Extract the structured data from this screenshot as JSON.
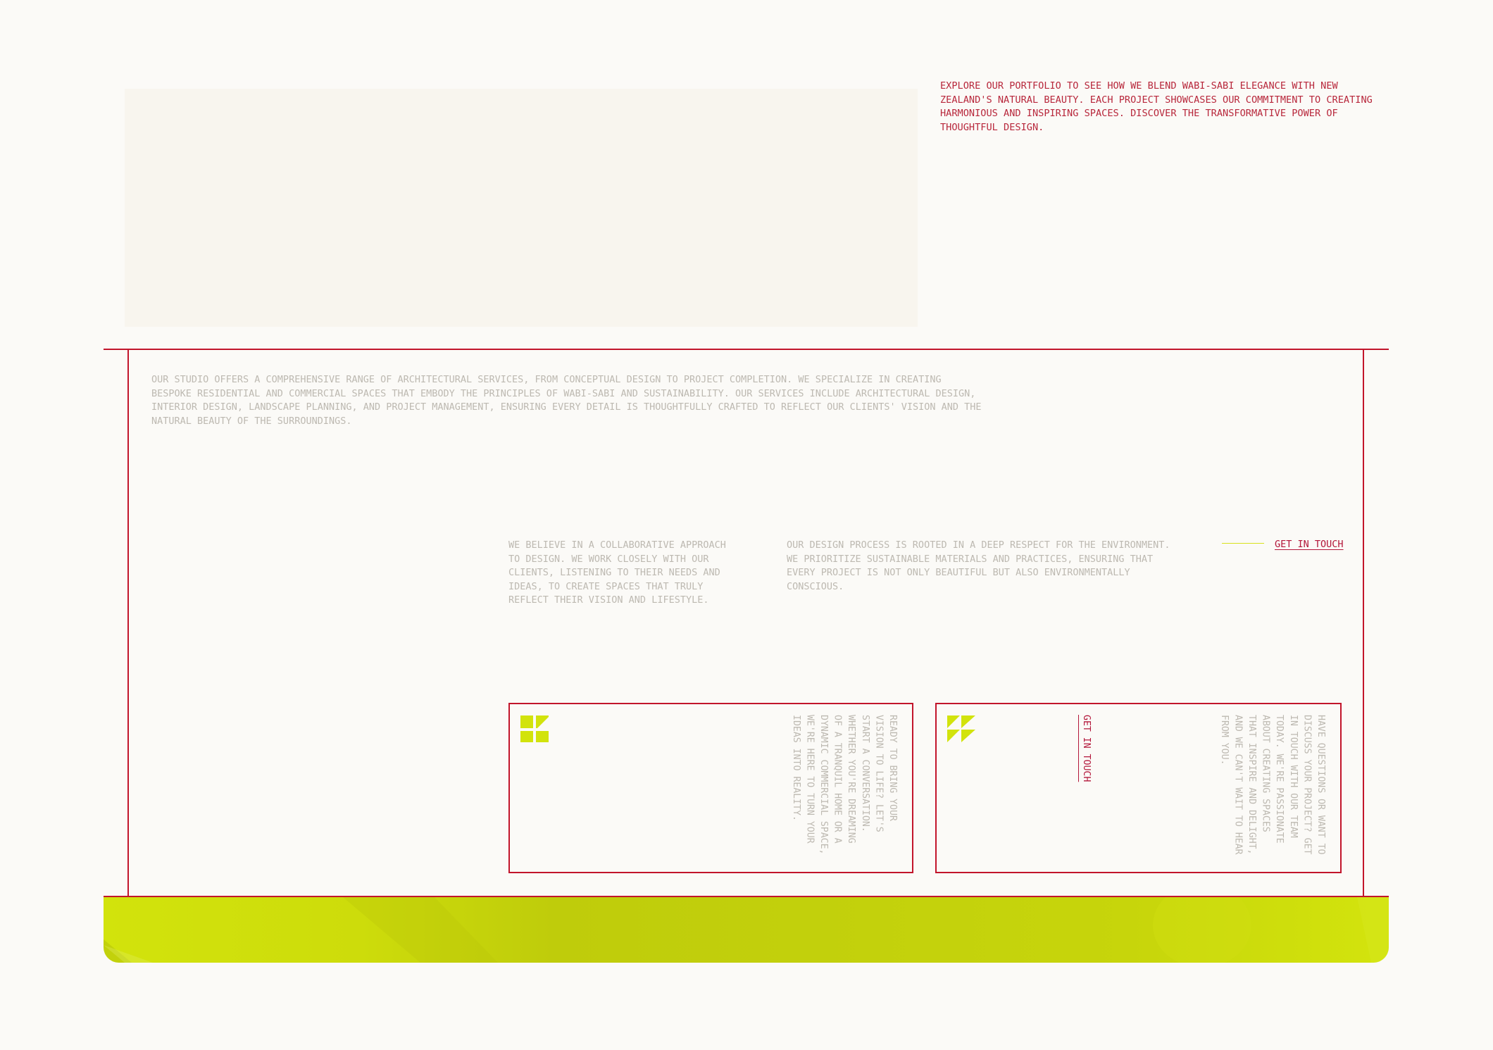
{
  "portfolio": {
    "text": "EXPLORE OUR PORTFOLIO TO SEE HOW WE BLEND WABI-SABI ELEGANCE WITH NEW ZEALAND'S NATURAL BEAUTY. EACH PROJECT SHOWCASES OUR COMMITMENT TO CREATING HARMONIOUS AND INSPIRING SPACES. DISCOVER THE TRANSFORMATIVE POWER OF THOUGHTFUL DESIGN."
  },
  "services": {
    "text": "OUR STUDIO OFFERS A COMPREHENSIVE RANGE OF ARCHITECTURAL SERVICES, FROM CONCEPTUAL DESIGN TO PROJECT COMPLETION. WE SPECIALIZE IN CREATING BESPOKE RESIDENTIAL AND COMMERCIAL SPACES THAT EMBODY THE PRINCIPLES OF WABI-SABI AND SUSTAINABILITY. OUR SERVICES INCLUDE ARCHITECTURAL DESIGN, INTERIOR DESIGN, LANDSCAPE PLANNING, AND PROJECT MANAGEMENT, ENSURING EVERY DETAIL IS THOUGHTFULLY CRAFTED TO REFLECT OUR CLIENTS' VISION AND THE NATURAL BEAUTY OF THE SURROUNDINGS."
  },
  "approach": {
    "collaborative": "WE BELIEVE IN A COLLABORATIVE APPROACH TO DESIGN. WE WORK CLOSELY WITH OUR CLIENTS, LISTENING TO THEIR NEEDS AND IDEAS, TO CREATE SPACES THAT TRULY REFLECT THEIR VISION AND LIFESTYLE.",
    "process": "OUR DESIGN PROCESS IS ROOTED IN A DEEP RESPECT FOR THE ENVIRONMENT. WE PRIORITIZE SUSTAINABLE MATERIALS AND PRACTICES, ENSURING THAT EVERY PROJECT IS NOT ONLY BEAUTIFUL BUT ALSO ENVIRONMENTALLY CONSCIOUS.",
    "cta_label": "GET IN TOUCH"
  },
  "cards": [
    {
      "icon": "square-shapes-icon",
      "text": "READY TO BRING YOUR VISION TO LIFE? LET'S START A CONVERSATION. WHETHER YOU'RE DREAMING OF A TRANQUIL HOME OR A DYNAMIC COMMERCIAL SPACE, WE'RE HERE TO TURN YOUR IDEAS INTO REALITY."
    },
    {
      "icon": "triangle-shapes-icon",
      "link_label": "GET IN TOUCH",
      "text": "HAVE QUESTIONS OR WANT TO DISCUSS YOUR PROJECT? GET IN TOUCH WITH OUR TEAM TODAY. WE'RE PASSIONATE ABOUT CREATING SPACES THAT INSPIRE AND DELIGHT, AND WE CAN'T WAIT TO HEAR FROM YOU."
    }
  ],
  "colors": {
    "accent_red": "#c2152b",
    "accent_yellow": "#d2e30c",
    "muted_text": "#bdb9b1",
    "background": "#fbfaf7"
  }
}
